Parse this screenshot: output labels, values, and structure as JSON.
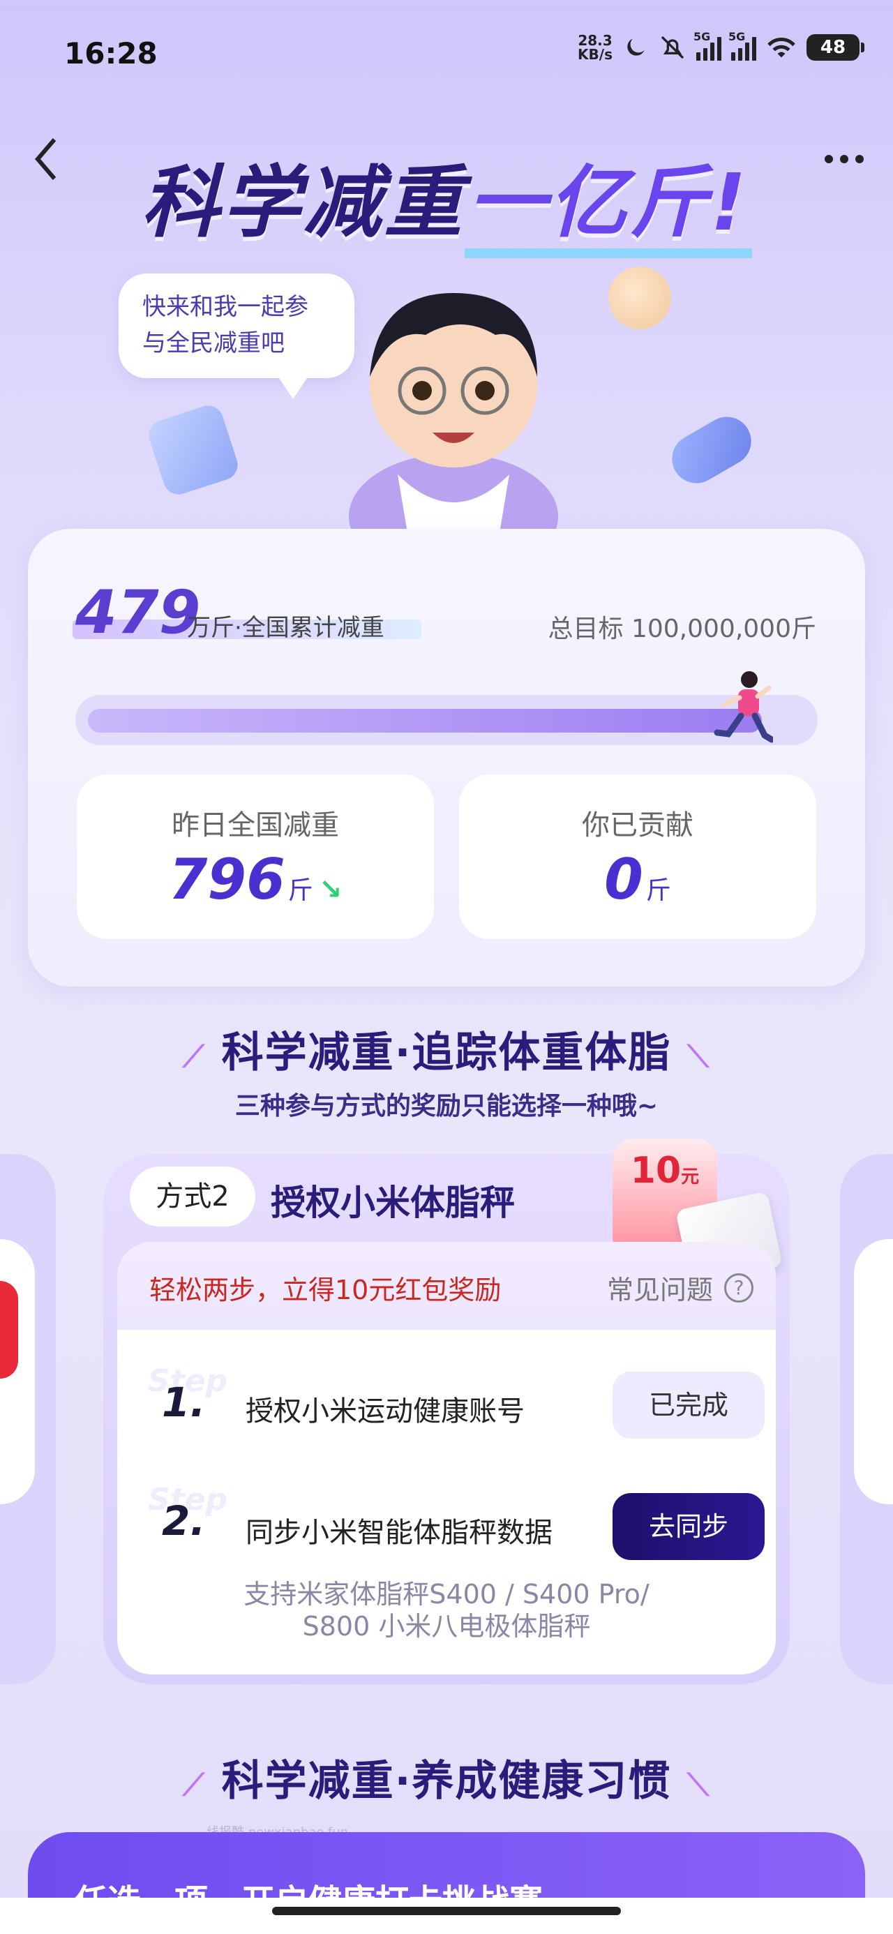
{
  "status_bar": {
    "time": "16:28",
    "net_speed_value": "28.3",
    "net_speed_unit": "KB/s",
    "sim1": "5G",
    "sim2": "5G",
    "battery": "48"
  },
  "icons": {
    "back": "chevron-left-icon",
    "more": "more-horizontal-icon",
    "moon": "moon-icon",
    "mute": "bell-off-icon",
    "wifi": "wifi-icon",
    "battery": "battery-icon",
    "faq": "question-circle-icon"
  },
  "hero": {
    "title_main": "科学减重",
    "title_highlight": "一亿斤!",
    "speech_bubble": "快来和我一起参与全民减重吧"
  },
  "stats": {
    "total_value": "479",
    "total_label": "万斤·全国累计减重",
    "goal_label": "总目标 100,000,000斤",
    "progress_percent": 94,
    "yesterday_label": "昨日全国减重",
    "yesterday_value": "796",
    "yesterday_unit": "斤",
    "contributed_label": "你已贡献",
    "contributed_value": "0",
    "contributed_unit": "斤"
  },
  "section1": {
    "title": "科学减重·追踪体重体脂",
    "subtitle": "三种参与方式的奖励只能选择一种哦~"
  },
  "method": {
    "tag": "方式2",
    "title": "授权小米体脂秤",
    "reward_amount": "10",
    "reward_unit": "元",
    "promo": "轻松两步，立得10元红包奖励",
    "faq_label": "常见问题",
    "steps": [
      {
        "num": "1.",
        "ghost": "Step",
        "text": "授权小米运动健康账号",
        "button": "已完成"
      },
      {
        "num": "2.",
        "ghost": "Step",
        "text": "同步小米智能体脂秤数据",
        "button": "去同步"
      }
    ],
    "support_line1": "支持米家体脂秤S400 / S400 Pro/",
    "support_line2": "S800 小米八电极体脂秤"
  },
  "section2": {
    "title": "科学减重·养成健康习惯"
  },
  "bottom": {
    "watermark": "线报酷 newxianbao.fun",
    "card_text": "任选一项，开启健康打卡挑战赛"
  }
}
